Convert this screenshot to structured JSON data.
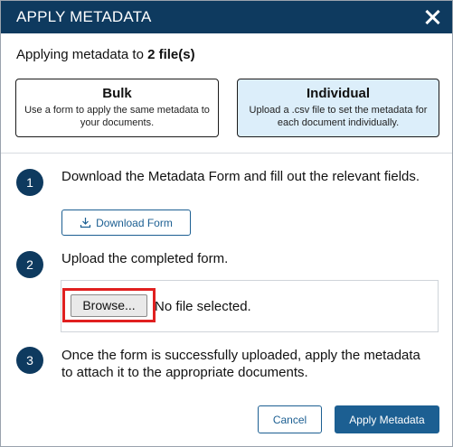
{
  "dialog": {
    "title": "APPLY METADATA"
  },
  "summary": {
    "prefix": "Applying metadata to ",
    "count_text": "2 file(s)"
  },
  "modes": {
    "bulk": {
      "title": "Bulk",
      "description": "Use a form to apply the same metadata to your documents."
    },
    "individual": {
      "title": "Individual",
      "description": "Upload a .csv file to set the metadata for each document individually."
    }
  },
  "steps": [
    {
      "number": "1",
      "text": "Download the Metadata Form and fill out the relevant fields."
    },
    {
      "number": "2",
      "text": "Upload the completed form."
    },
    {
      "number": "3",
      "text": "Once the form is successfully uploaded, apply the metadata to attach it to the appropriate documents."
    }
  ],
  "download_button": {
    "label": "Download Form",
    "icon": "download-icon"
  },
  "file_upload": {
    "browse_label": "Browse...",
    "status": "No file selected."
  },
  "footer": {
    "cancel_label": "Cancel",
    "apply_label": "Apply Metadata"
  },
  "colors": {
    "header_bg": "#0e3a5f",
    "primary": "#1c5f92",
    "selected_mode_bg": "#dceefa",
    "highlight": "#e02020"
  }
}
